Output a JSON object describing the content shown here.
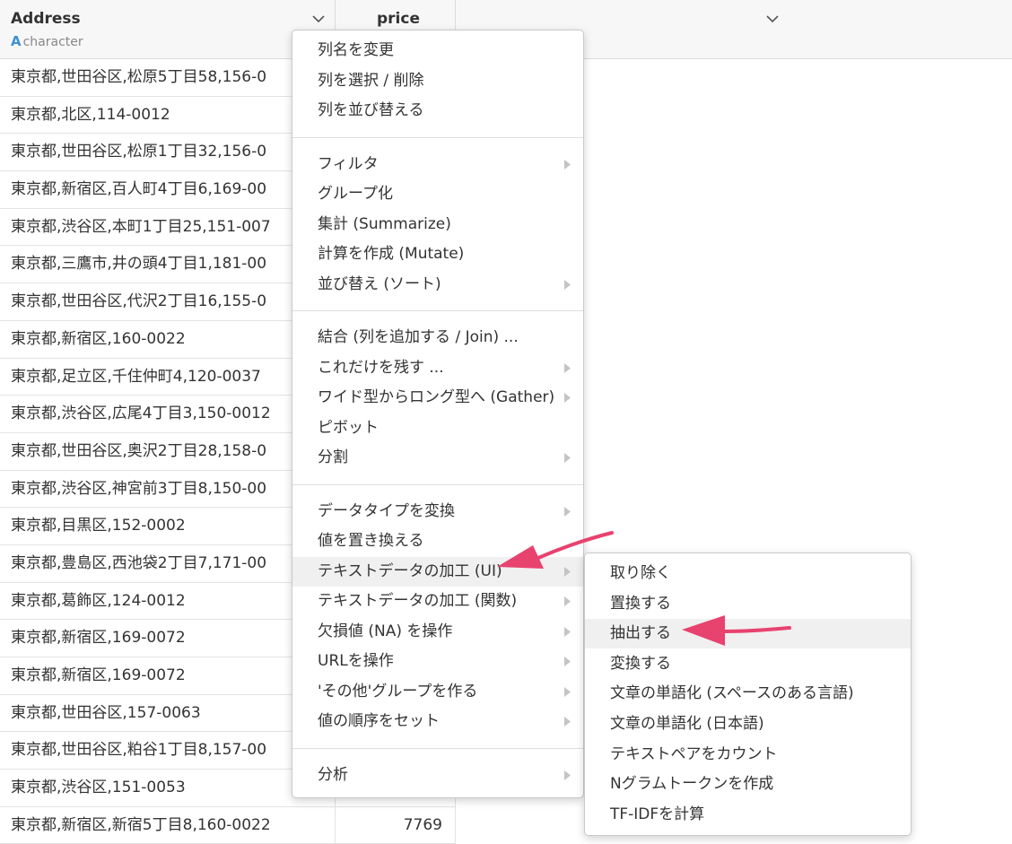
{
  "table": {
    "columns": [
      {
        "name": "Address",
        "type_badge": "A",
        "type_label": "character"
      },
      {
        "name": "price"
      }
    ],
    "rows": [
      {
        "address": "東京都,世田谷区,松原5丁目58,156-0",
        "price": ""
      },
      {
        "address": "東京都,北区,114-0012",
        "price": ""
      },
      {
        "address": "東京都,世田谷区,松原1丁目32,156-0",
        "price": ""
      },
      {
        "address": "東京都,新宿区,百人町4丁目6,169-00",
        "price": ""
      },
      {
        "address": "東京都,渋谷区,本町1丁目25,151-007",
        "price": ""
      },
      {
        "address": "東京都,三鷹市,井の頭4丁目1,181-00",
        "price": ""
      },
      {
        "address": "東京都,世田谷区,代沢2丁目16,155-0",
        "price": ""
      },
      {
        "address": "東京都,新宿区,160-0022",
        "price": ""
      },
      {
        "address": "東京都,足立区,千住仲町4,120-0037",
        "price": ""
      },
      {
        "address": "東京都,渋谷区,広尾4丁目3,150-0012",
        "price": ""
      },
      {
        "address": "東京都,世田谷区,奥沢2丁目28,158-0",
        "price": ""
      },
      {
        "address": "東京都,渋谷区,神宮前3丁目8,150-00",
        "price": ""
      },
      {
        "address": "東京都,目黒区,152-0002",
        "price": ""
      },
      {
        "address": "東京都,豊島区,西池袋2丁目7,171-00",
        "price": ""
      },
      {
        "address": "東京都,葛飾区,124-0012",
        "price": ""
      },
      {
        "address": "東京都,新宿区,169-0072",
        "price": ""
      },
      {
        "address": "東京都,新宿区,169-0072",
        "price": ""
      },
      {
        "address": "東京都,世田谷区,157-0063",
        "price": ""
      },
      {
        "address": "東京都,世田谷区,粕谷1丁目8,157-00",
        "price": ""
      },
      {
        "address": "東京都,渋谷区,151-0053",
        "price": ""
      },
      {
        "address": "東京都,新宿区,新宿5丁目8,160-0022",
        "price": "7769"
      }
    ]
  },
  "menu": {
    "groups": [
      [
        {
          "label": "列名を変更",
          "submenu": false
        },
        {
          "label": "列を選択 / 削除",
          "submenu": false
        },
        {
          "label": "列を並び替える",
          "submenu": false
        }
      ],
      [
        {
          "label": "フィルタ",
          "submenu": true
        },
        {
          "label": "グループ化",
          "submenu": false
        },
        {
          "label": "集計 (Summarize)",
          "submenu": false
        },
        {
          "label": "計算を作成 (Mutate)",
          "submenu": false
        },
        {
          "label": "並び替え (ソート)",
          "submenu": true
        }
      ],
      [
        {
          "label": "結合 (列を追加する / Join) ...",
          "submenu": false
        },
        {
          "label": "これだけを残す ...",
          "submenu": true
        },
        {
          "label": "ワイド型からロング型へ (Gather)",
          "submenu": true
        },
        {
          "label": "ピボット",
          "submenu": false
        },
        {
          "label": "分割",
          "submenu": true
        }
      ],
      [
        {
          "label": "データタイプを変換",
          "submenu": true
        },
        {
          "label": "値を置き換える",
          "submenu": false
        },
        {
          "label": "テキストデータの加工 (UI)",
          "submenu": true,
          "highlighted": true
        },
        {
          "label": "テキストデータの加工 (関数)",
          "submenu": true
        },
        {
          "label": "欠損値 (NA) を操作",
          "submenu": true
        },
        {
          "label": "URLを操作",
          "submenu": true
        },
        {
          "label": "'その他'グループを作る",
          "submenu": true
        },
        {
          "label": "値の順序をセット",
          "submenu": true
        }
      ],
      [
        {
          "label": "分析",
          "submenu": true
        }
      ]
    ]
  },
  "submenu": {
    "items": [
      {
        "label": "取り除く"
      },
      {
        "label": "置換する"
      },
      {
        "label": "抽出する",
        "highlighted": true
      },
      {
        "label": "変換する"
      },
      {
        "label": "文章の単語化 (スペースのある言語)"
      },
      {
        "label": "文章の単語化 (日本語)"
      },
      {
        "label": "テキストペアをカウント"
      },
      {
        "label": "Nグラムトークンを作成"
      },
      {
        "label": "TF-IDFを計算"
      }
    ]
  },
  "colors": {
    "type_badge": "#3d8fd6",
    "annotation_arrow": "#e8426f",
    "highlight": "#f0f0f0"
  },
  "icons": {
    "column_menu": "chevron-down-icon",
    "submenu_indicator": "chevron-right-icon",
    "annotation": "pointer-arrow-icon"
  }
}
